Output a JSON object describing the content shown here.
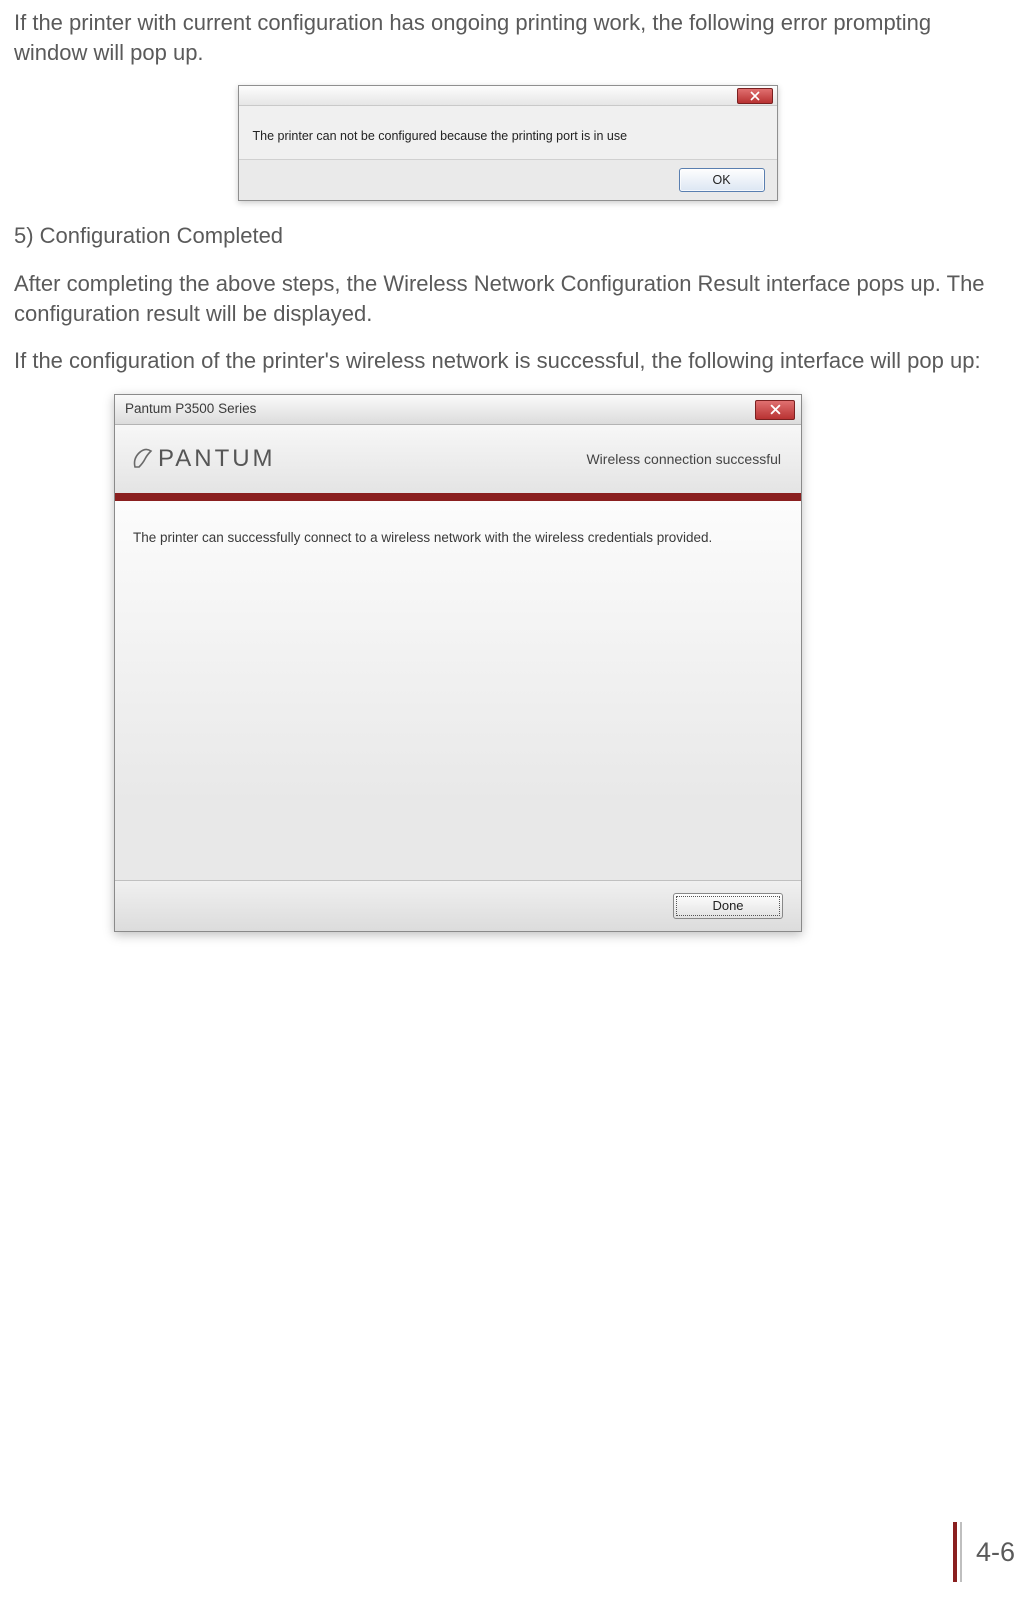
{
  "paragraphs": {
    "intro1": "If the printer with current configuration has ongoing printing work, the following error prompting window will pop up.",
    "heading5": "5) Configuration Completed",
    "after1": "After completing the above steps, the Wireless Network Configuration Result interface pops up. The configuration result will be displayed.",
    "after2": "If the configuration of the printer's wireless network is successful, the following interface will pop up:"
  },
  "error_dialog": {
    "message": "The printer can not be configured because the printing port is in use",
    "ok_label": "OK"
  },
  "success_dialog": {
    "title": "Pantum P3500 Series",
    "logo_text": "PANTUM",
    "header_status": "Wireless connection successful",
    "body_text": "The printer can successfully connect to a wireless network with the wireless credentials provided.",
    "done_label": "Done"
  },
  "page_number": "4-6"
}
